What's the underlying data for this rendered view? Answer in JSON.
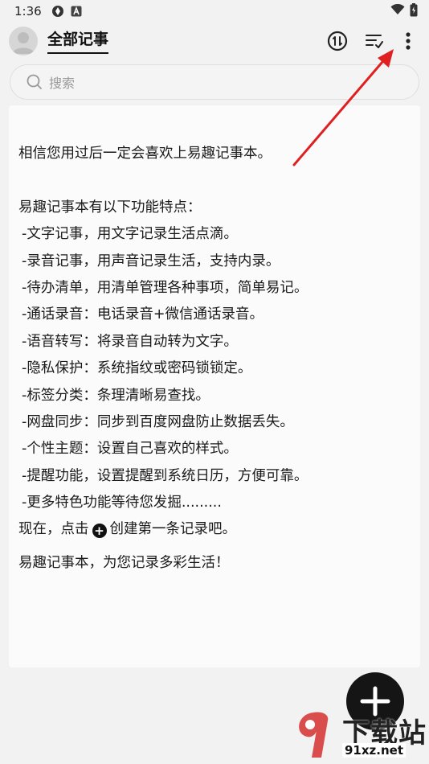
{
  "status_bar": {
    "time": "1:36"
  },
  "header": {
    "title": "全部记事"
  },
  "search": {
    "placeholder": "搜索"
  },
  "note": {
    "intro": "相信您用过后一定会喜欢上易趣记事本。",
    "features_heading": "易趣记事本有以下功能特点：",
    "features": [
      "-文字记事，用文字记录生活点滴。",
      "-录音记事，用声音记录生活，支持内录。",
      "-待办清单，用清单管理各种事项，简单易记。",
      "-通话录音：电话录音+微信通话录音。",
      "-语音转写：将录音自动转为文字。",
      "-隐私保护：系统指纹或密码锁锁定。",
      "-标签分类：条理清晰易查找。",
      "-网盘同步：同步到百度网盘防止数据丢失。",
      "-个性主题：设置自己喜欢的样式。",
      "-提醒功能，设置提醒到系统日历，方便可靠。",
      "-更多特色功能等待您发掘........."
    ],
    "cta_before": "现在，点击",
    "cta_after": "创建第一条记录吧。",
    "closing": "易趣记事本，为您记录多彩生活！"
  },
  "watermark": {
    "text_big": "下载站",
    "text_small": "91xz.net"
  },
  "colors": {
    "accent_arrow": "#e02020",
    "fab": "#151515"
  }
}
